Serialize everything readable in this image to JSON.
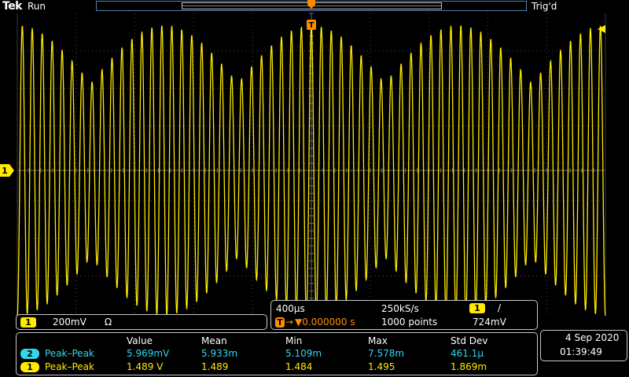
{
  "header": {
    "brand": "Tek",
    "run_state": "Run",
    "trigger_state": "Trig'd"
  },
  "markers": {
    "trigger_pos_label": "T",
    "channel1_label": "1"
  },
  "colors": {
    "channel1": "#ffea00",
    "channel2": "#30d8e8",
    "trigger_marker": "#ff8c00",
    "graticule": "#4a4a4a",
    "background": "#000000"
  },
  "channel_panel": {
    "channel": "1",
    "scale": "200mV",
    "coupling": "Ω"
  },
  "timebase_panel": {
    "time_per_div": "400µs",
    "sample_rate": "250kS/s",
    "record_length": "1000 points",
    "trigger_marker": "T",
    "trigger_position": "▼0.000000 s",
    "trigger_source": "1",
    "trigger_slope": "/",
    "trigger_level": "724mV"
  },
  "measurements": {
    "headers": [
      "Value",
      "Mean",
      "Min",
      "Max",
      "Std Dev"
    ],
    "rows": [
      {
        "channel": "2",
        "name": "Peak–Peak",
        "value": "5.969mV",
        "mean": "5.933m",
        "min": "5.109m",
        "max": "7.578m",
        "std_dev": "461.1µ"
      },
      {
        "channel": "1",
        "name": "Peak–Peak",
        "value": "1.489 V",
        "mean": "1.489",
        "min": "1.484",
        "max": "1.495",
        "std_dev": "1.869m"
      }
    ]
  },
  "datetime": {
    "date": "4 Sep  2020",
    "time": "01:39:49"
  },
  "waveform": {
    "channel": "1",
    "shape": "amplitude-modulated sine (beat pattern)",
    "carrier_cycles_on_screen": 59,
    "beat_cycles_on_screen": 4,
    "peak_to_peak": "1.489 V"
  }
}
